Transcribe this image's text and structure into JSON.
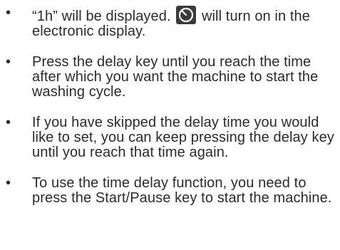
{
  "instructions": {
    "bullet_glyph": "•",
    "items": [
      {
        "text_before_icon": "“1h” will be displayed.",
        "icon": "delay-timer-icon",
        "text_after_icon": "will turn on in the electronic display."
      },
      {
        "text": "Press the delay key until you reach the time after which you want the machine to start the washing cycle."
      },
      {
        "text": "If you have skipped the delay time you would like to set, you can keep pressing the delay key until you reach that time again."
      },
      {
        "text": "To use the time delay function, you need to press the Start/Pause key to start the machine."
      }
    ]
  },
  "colors": {
    "text": "#2b2b2b",
    "icon_fill": "#3a3a3a",
    "icon_ring": "#ffffff"
  }
}
